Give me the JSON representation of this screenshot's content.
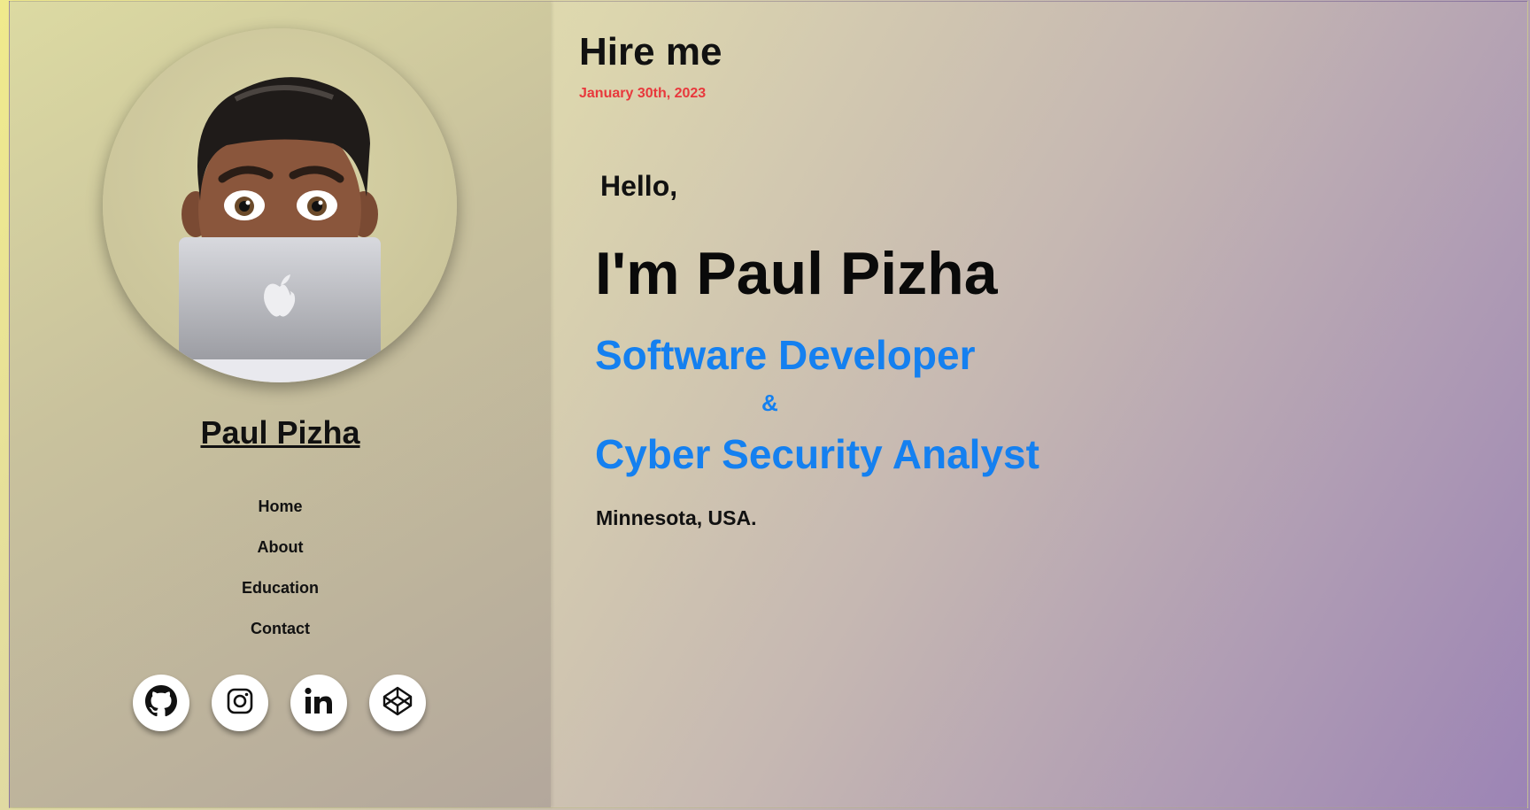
{
  "sidebar": {
    "name": "Paul Pizha",
    "nav": [
      "Home",
      "About",
      "Education",
      "Contact"
    ],
    "socials": [
      "github-icon",
      "instagram-icon",
      "linkedin-icon",
      "codepen-icon"
    ]
  },
  "main": {
    "hire_label": "Hire me",
    "date": "January 30th, 2023",
    "greeting": "Hello,",
    "headline": "I'm Paul Pizha",
    "role_primary": "Software Developer",
    "role_separator": "&",
    "role_secondary": "Cyber Security Analyst",
    "location": "Minnesota, USA."
  },
  "colors": {
    "accent": "#1480f0",
    "date": "#e8383c"
  }
}
